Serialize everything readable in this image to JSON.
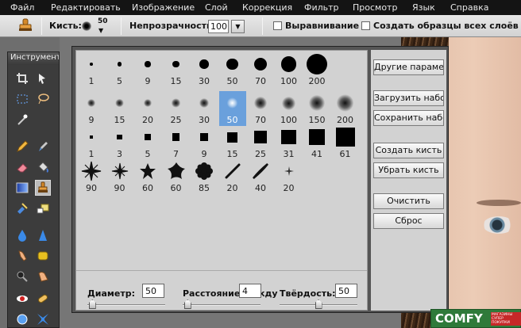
{
  "menu": [
    "Файл",
    "Редактировать",
    "Изображение",
    "Слой",
    "Коррекция",
    "Фильтр",
    "Просмотр",
    "Язык",
    "Справка"
  ],
  "options": {
    "brush_label": "Кисть:",
    "brush_size": "50",
    "opacity_label": "Непрозрачность:",
    "opacity_value": "100",
    "aligned_label": "Выравнивание",
    "aligned_checked": false,
    "sample_all_label": "Создать образцы всех слоёв",
    "sample_all_checked": false
  },
  "tools_panel": {
    "title": "Инструменты",
    "tools": [
      "crop-icon",
      "move-icon",
      "marquee-icon",
      "lasso-icon",
      "magic-wand-icon",
      "pencil-icon",
      "brush-icon",
      "eraser-icon",
      "paint-bucket-icon",
      "gradient-icon",
      "clone-stamp-icon",
      "color-replace-icon",
      "shape-icon",
      "blur-icon",
      "sharpen-icon",
      "smudge-icon",
      "sponge-icon",
      "dodge-icon",
      "burn-icon",
      "red-eye-icon",
      "spot-heal-icon",
      "bloat-icon",
      "pinch-icon"
    ],
    "active": "clone-stamp-icon"
  },
  "brush_picker": {
    "rows": [
      {
        "kind": "hard",
        "sizes": [
          "1",
          "5",
          "9",
          "15",
          "30",
          "50",
          "70",
          "100",
          "200"
        ]
      },
      {
        "kind": "soft",
        "sizes": [
          "9",
          "15",
          "20",
          "25",
          "30",
          "50",
          "70",
          "100",
          "150",
          "200"
        ]
      },
      {
        "kind": "square",
        "sizes": [
          "1",
          "3",
          "5",
          "7",
          "9",
          "15",
          "25",
          "31",
          "41",
          "61"
        ]
      },
      {
        "kind": "shape",
        "sizes": [
          "90",
          "90",
          "60",
          "60",
          "85",
          "20",
          "40",
          "20"
        ]
      }
    ],
    "selected": "50",
    "buttons": [
      "Другие параметры",
      "Загрузить набор",
      "Сохранить набор",
      "Создать кисть",
      "Убрать кисть",
      "Очистить",
      "Сброс"
    ],
    "diameter_label": "Диаметр:",
    "diameter_value": "50",
    "diameter_fraction": 0.02,
    "spacing_label": "Расстояние между символами:",
    "spacing_value": "4",
    "spacing_fraction": 0.02,
    "hardness_label": "Твёрдость:",
    "hardness_value": "50",
    "hardness_fraction": 0.5
  },
  "logo": {
    "main": "COMFY",
    "sub": "МАГАЗИНЫ СУПЕР ПОКУПКИ"
  }
}
